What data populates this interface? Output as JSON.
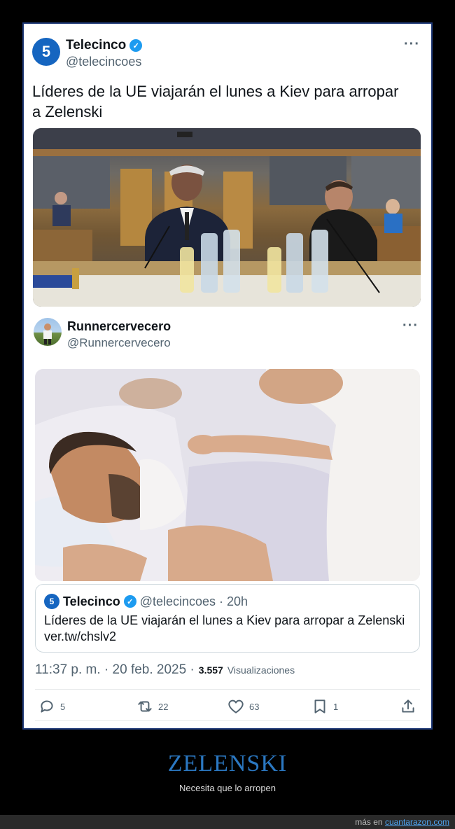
{
  "outer_tweet": {
    "avatar_glyph": "5",
    "name": "Telecinco",
    "verified_glyph": "✓",
    "handle": "@telecincoes",
    "more": "···",
    "text": "Líderes de la UE viajarán el lunes a Kiev para arropar a Zelenski"
  },
  "inner_tweet": {
    "name": "Runnercervecero",
    "handle": "@Runnercervecero",
    "more": "···",
    "quote": {
      "avatar_glyph": "5",
      "name": "Telecinco",
      "verified_glyph": "✓",
      "handle": "@telecincoes",
      "time": "· 20h",
      "text": "Líderes de la UE viajarán el lunes a Kiev para arropar a Zelenski ver.tw/chslv2"
    },
    "timestamp": "11:37 p. m. · 20 feb. 2025 ·",
    "views_count": "3.557",
    "views_label": "Visualizaciones",
    "actions": {
      "replies": "5",
      "retweets": "22",
      "likes": "63",
      "bookmarks": "1"
    }
  },
  "caption": {
    "title": "ZELENSKI",
    "subtitle": "Necesita que lo arropen"
  },
  "footer": {
    "prefix": "más en",
    "link": "cuantarazon.com"
  },
  "colors": {
    "verified": "#1d9bf0",
    "telecinco_brand": "#1565c0",
    "caption_title": "#2b78c2",
    "frame_border": "#1f3a78"
  },
  "icons": [
    "more-icon",
    "verified-icon",
    "reply-icon",
    "retweet-icon",
    "like-icon",
    "bookmark-icon",
    "share-icon"
  ]
}
